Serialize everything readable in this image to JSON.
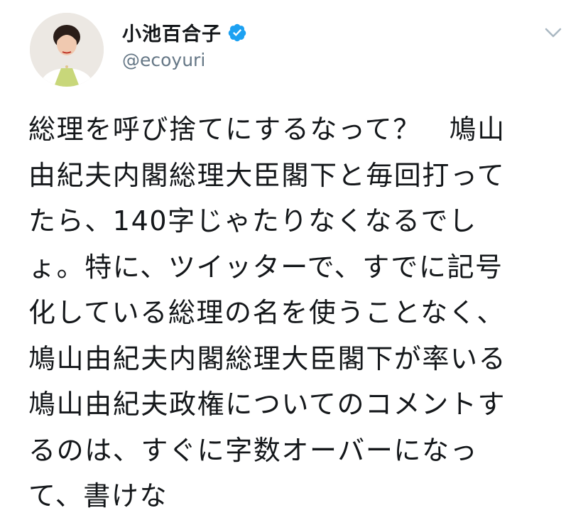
{
  "user": {
    "display_name": "小池百合子",
    "handle": "@ecoyuri",
    "verified_icon": "verified-badge-icon",
    "menu_icon": "chevron-down-icon"
  },
  "tweet": {
    "lines": [
      "総理を呼び捨てにするなって？　鳩山",
      "由紀夫内閣総理大臣閣下と毎回打って",
      "たら、140字じゃたりなくなるでし",
      "ょ。特に、ツイッターで、すでに記号",
      "化している総理の名を使うことなく、",
      "鳩山由紀夫内閣総理大臣閣下が率いる",
      "鳩山由紀夫政権についてのコメントす",
      "るのは、すぐに字数オーバーになっ",
      "て、書けな"
    ]
  },
  "colors": {
    "verified_blue": "#1da1f2",
    "text": "#14171a",
    "secondary_text": "#657786",
    "chevron": "#aab8c2"
  }
}
